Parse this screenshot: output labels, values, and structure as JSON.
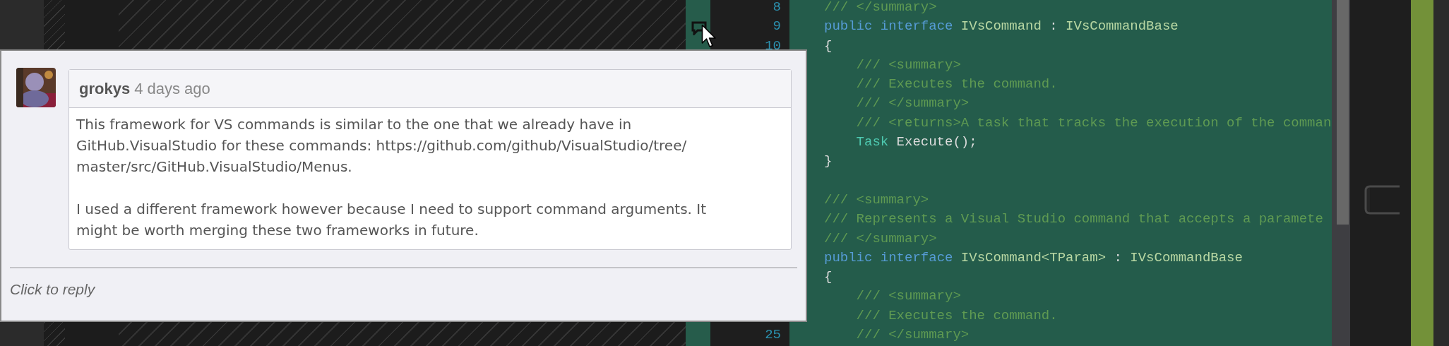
{
  "comment": {
    "author": "grokys",
    "time": "4 days ago",
    "paragraphs": [
      {
        "lines": [
          "This framework for VS commands is similar to the one that we already have in",
          "GitHub.VisualStudio for these commands: https://github.com/github/VisualStudio/tree/",
          "master/src/GitHub.VisualStudio/Menus."
        ]
      },
      {
        "lines": [
          "I used a different framework however because I need to support command arguments. It",
          "might be worth merging these two frameworks in future."
        ]
      }
    ],
    "reply_placeholder": "Click to reply"
  },
  "editor": {
    "blocks": [
      {
        "lines": [
          {
            "number": "8",
            "tokens": [
              {
                "kind": "comment",
                "text": "/// </summary>"
              }
            ]
          },
          {
            "number": "9",
            "has_comment": true,
            "tokens": [
              {
                "kind": "keyword",
                "text": "public interface "
              },
              {
                "kind": "type",
                "text": "IVsCommand"
              },
              {
                "kind": "plain",
                "text": " : "
              },
              {
                "kind": "type",
                "text": "IVsCommandBase"
              }
            ]
          },
          {
            "number": "10",
            "tokens": [
              {
                "kind": "plain",
                "text": "{"
              }
            ]
          },
          {
            "indented": true,
            "tokens": [
              {
                "kind": "comment",
                "text": "/// <summary>"
              }
            ]
          },
          {
            "indented": true,
            "tokens": [
              {
                "kind": "comment",
                "text": "/// Executes the command."
              }
            ]
          },
          {
            "indented": true,
            "tokens": [
              {
                "kind": "comment",
                "text": "/// </summary>"
              }
            ]
          },
          {
            "indented": true,
            "tokens": [
              {
                "kind": "comment",
                "text": "/// <returns>A task that tracks the execution of the comman"
              }
            ]
          },
          {
            "indented": true,
            "tokens": [
              {
                "kind": "class",
                "text": "Task"
              },
              {
                "kind": "plain",
                "text": " Execute();"
              }
            ]
          },
          {
            "tokens": [
              {
                "kind": "plain",
                "text": "}"
              }
            ]
          }
        ]
      },
      {
        "lines": [
          {
            "tokens": [
              {
                "kind": "comment",
                "text": "/// <summary>"
              }
            ]
          },
          {
            "tokens": [
              {
                "kind": "comment",
                "text": "/// Represents a Visual Studio command that accepts a paramete"
              }
            ]
          },
          {
            "tokens": [
              {
                "kind": "comment",
                "text": "/// </summary>"
              }
            ]
          },
          {
            "tokens": [
              {
                "kind": "keyword",
                "text": "public interface "
              },
              {
                "kind": "type",
                "text": "IVsCommand<TParam>"
              },
              {
                "kind": "plain",
                "text": " : "
              },
              {
                "kind": "type",
                "text": "IVsCommandBase"
              }
            ]
          },
          {
            "tokens": [
              {
                "kind": "plain",
                "text": "{"
              }
            ]
          },
          {
            "indented": true,
            "tokens": [
              {
                "kind": "comment",
                "text": "/// <summary>"
              }
            ]
          },
          {
            "indented": true,
            "tokens": [
              {
                "kind": "comment",
                "text": "/// Executes the command."
              }
            ]
          },
          {
            "number": "25",
            "indented": true,
            "tokens": [
              {
                "kind": "comment",
                "text": "/// </summary>"
              }
            ]
          }
        ]
      }
    ]
  }
}
